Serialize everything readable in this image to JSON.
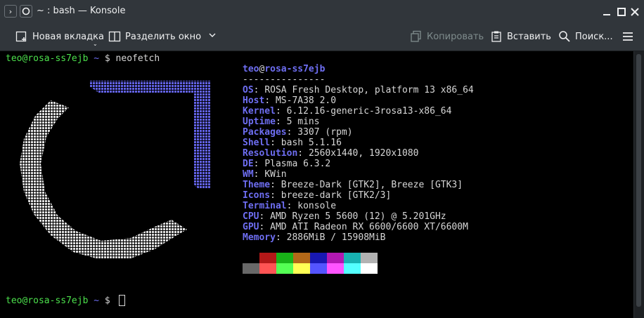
{
  "window": {
    "title": "~ : bash — Konsole"
  },
  "toolbar": {
    "new_tab": "Новая вкладка",
    "split_view": "Разделить окно",
    "copy": "Копировать",
    "paste": "Вставить",
    "find": "Поиск..."
  },
  "terminal": {
    "prompt_user": "teo@rosa-ss7ejb",
    "prompt_path": "~",
    "prompt_symbol": "$",
    "command": "neofetch",
    "info_user": "teo",
    "info_at": "@",
    "info_host": "rosa-ss7ejb",
    "separator": "---------------",
    "info": [
      {
        "key": "OS",
        "value": "ROSA Fresh Desktop, platform 13 x86_64"
      },
      {
        "key": "Host",
        "value": "MS-7A38 2.0"
      },
      {
        "key": "Kernel",
        "value": "6.12.16-generic-3rosa13-x86_64"
      },
      {
        "key": "Uptime",
        "value": "5 mins"
      },
      {
        "key": "Packages",
        "value": "3307 (rpm)"
      },
      {
        "key": "Shell",
        "value": "bash 5.1.16"
      },
      {
        "key": "Resolution",
        "value": "2560x1440, 1920x1080"
      },
      {
        "key": "DE",
        "value": "Plasma 6.3.2"
      },
      {
        "key": "WM",
        "value": "KWin"
      },
      {
        "key": "Theme",
        "value": "Breeze-Dark [GTK2], Breeze [GTK3]"
      },
      {
        "key": "Icons",
        "value": "breeze-dark [GTK2/3]"
      },
      {
        "key": "Terminal",
        "value": "konsole"
      },
      {
        "key": "CPU",
        "value": "AMD Ryzen 5 5600 (12) @ 5.201GHz"
      },
      {
        "key": "GPU",
        "value": "AMD ATI Radeon RX 6600/6600 XT/6600M"
      },
      {
        "key": "Memory",
        "value": "2886MiB / 15908MiB"
      }
    ],
    "palette_top": [
      "#000000",
      "#b21818",
      "#18b218",
      "#b26818",
      "#1818b2",
      "#b218b2",
      "#18b2b2",
      "#b2b2b2"
    ],
    "palette_bottom": [
      "#686868",
      "#ff5454",
      "#54ff54",
      "#ffff54",
      "#5454ff",
      "#ff54ff",
      "#54ffff",
      "#ffffff"
    ]
  }
}
